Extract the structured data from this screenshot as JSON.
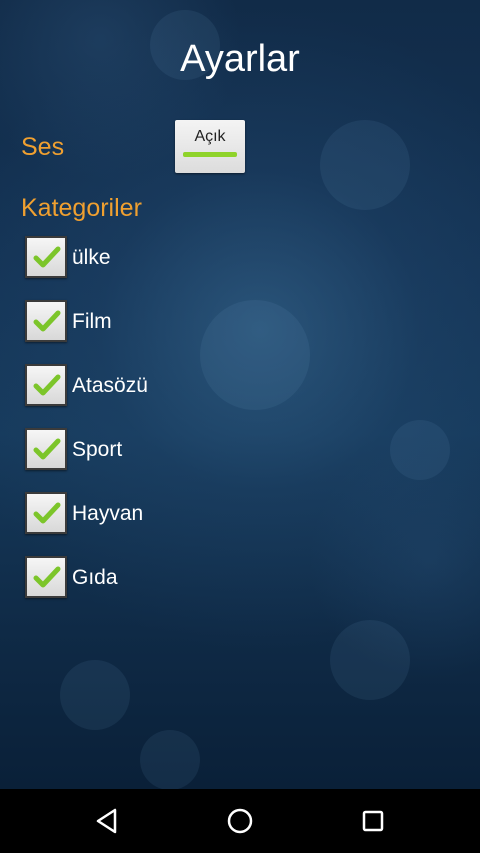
{
  "screen": {
    "title": "Ayarlar"
  },
  "sound": {
    "label": "Ses",
    "toggle_text": "Açık",
    "toggle_on": true,
    "toggle_indicator_color": "#8fd32a"
  },
  "categories": {
    "label": "Kategoriler",
    "items": [
      {
        "label": "ülke",
        "checked": true
      },
      {
        "label": "Film",
        "checked": true
      },
      {
        "label": "Atasözü",
        "checked": true
      },
      {
        "label": "Sport",
        "checked": true
      },
      {
        "label": "Hayvan",
        "checked": true
      },
      {
        "label": "Gıda",
        "checked": true
      }
    ]
  },
  "navbar": {
    "back_icon": "back-triangle-icon",
    "home_icon": "home-circle-icon",
    "recents_icon": "recents-square-icon"
  },
  "colors": {
    "accent_label": "#f0a030",
    "check_green": "#7cc52a",
    "background": "#143456"
  }
}
